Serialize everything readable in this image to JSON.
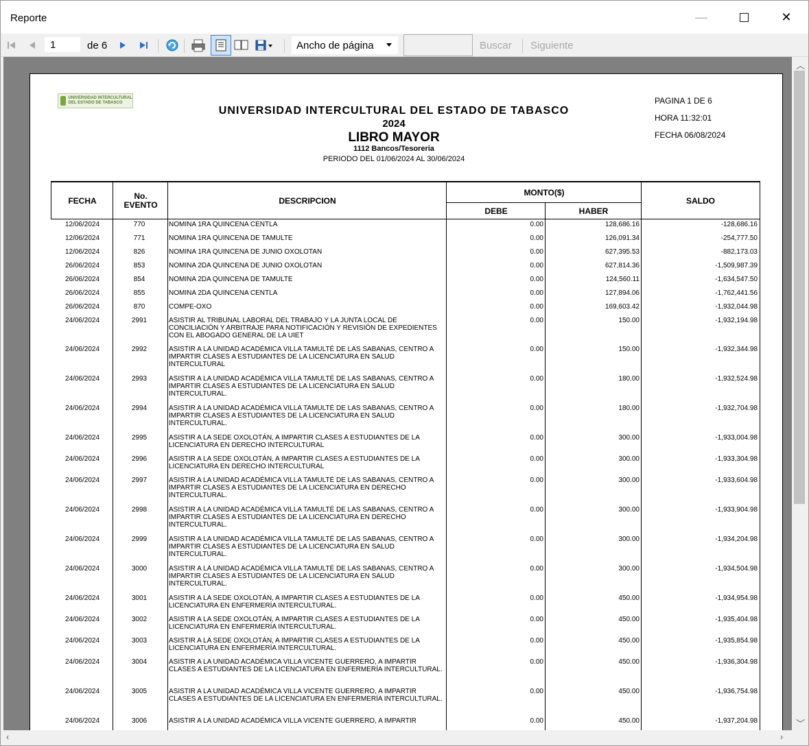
{
  "window": {
    "title": "Reporte"
  },
  "toolbar": {
    "page_current": "1",
    "page_of": "de 6",
    "zoom": "Ancho de página",
    "search_label": "Buscar",
    "next_label": "Siguiente"
  },
  "report": {
    "institution": "UNIVERSIDAD INTERCULTURAL DEL ESTADO DE TABASCO",
    "year": "2024",
    "book": "LIBRO MAYOR",
    "account": "1112 Bancos/Tesoreria",
    "period": "PERIODO DEL 01/06/2024 AL 30/06/2024",
    "page_info": "PAGINA 1 DE 6",
    "time": "HORA  11:32:01",
    "date": "FECHA 06/08/2024",
    "logo_text": "UNIVERSIDAD INTERCULTURAL DEL ESTADO DE TABASCO"
  },
  "table": {
    "headers": {
      "fecha": "FECHA",
      "evento": "No. EVENTO",
      "descripcion": "DESCRIPCION",
      "monto": "MONTO($)",
      "debe": "DEBE",
      "haber": "HABER",
      "saldo": "SALDO"
    },
    "rows": [
      {
        "fecha": "12/06/2024",
        "evento": "770",
        "desc": "NOMINA 1RA QUINCENA CENTLA",
        "debe": "0.00",
        "haber": "128,686.16",
        "saldo": "-128,686.16"
      },
      {
        "fecha": "12/06/2024",
        "evento": "771",
        "desc": "NOMINA 1RA QUINCENA DE TAMULTE",
        "debe": "0.00",
        "haber": "126,091.34",
        "saldo": "-254,777.50"
      },
      {
        "fecha": "12/06/2024",
        "evento": "826",
        "desc": "NOMINA 1RA QUINCENA DE JUNIO OXOLOTAN",
        "debe": "0.00",
        "haber": "627,395.53",
        "saldo": "-882,173.03"
      },
      {
        "fecha": "26/06/2024",
        "evento": "853",
        "desc": "NOMINA 2DA QUINCENA DE JUNIO OXOLOTAN",
        "debe": "0.00",
        "haber": "627,814.36",
        "saldo": "-1,509,987.39"
      },
      {
        "fecha": "26/06/2024",
        "evento": "854",
        "desc": "NOMINA 2DA QUINCENA DE TAMULTE",
        "debe": "0.00",
        "haber": "124,560.11",
        "saldo": "-1,634,547.50"
      },
      {
        "fecha": "26/06/2024",
        "evento": "855",
        "desc": "NOMINA 2DA QUINCENA CENTLA",
        "debe": "0.00",
        "haber": "127,894.06",
        "saldo": "-1,762,441.56"
      },
      {
        "fecha": "26/06/2024",
        "evento": "870",
        "desc": "COMPE-OXO",
        "debe": "0.00",
        "haber": "169,603.42",
        "saldo": "-1,932,044.98"
      },
      {
        "fecha": "24/06/2024",
        "evento": "2991",
        "desc": "ASISTIR AL TRIBUNAL LABORAL DEL TRABAJO Y LA JUNTA LOCAL DE CONCILIACIÓN Y ARBITRAJE PARA NOTIFICACIÓN Y REVISIÓN DE EXPEDIENTES CON EL ABOGADO GENERAL DE LA UIET",
        "debe": "0.00",
        "haber": "150.00",
        "saldo": "-1,932,194.98"
      },
      {
        "fecha": "24/06/2024",
        "evento": "2992",
        "desc": "ASISTIR A LA UNIDAD ACADÉMICA VILLA TAMULTÉ DE LAS SABANAS, CENTRO A IMPARTIR CLASES A ESTUDIANTES DE LA LICENCIATURA EN SALUD INTERCULTURAL",
        "debe": "0.00",
        "haber": "150.00",
        "saldo": "-1,932,344.98"
      },
      {
        "fecha": "24/06/2024",
        "evento": "2993",
        "desc": "ASISTIR A LA UNIDAD ACADÉMICA VILLA TAMULTÉ DE LAS SABANAS, CENTRO A IMPARTIR CLASES A ESTUDIANTES DE LA LICENCIATURA EN SALUD INTERCULTURAL.",
        "debe": "0.00",
        "haber": "180.00",
        "saldo": "-1,932,524.98"
      },
      {
        "fecha": "24/06/2024",
        "evento": "2994",
        "desc": "ASISTIR A LA UNIDAD ACADÉMICA VILLA TAMULTÉ DE LAS SABANAS, CENTRO A IMPARTIR CLASES A ESTUDIANTES DE LA LICENCIATURA EN SALUD INTERCULTURAL.",
        "debe": "0.00",
        "haber": "180.00",
        "saldo": "-1,932,704.98"
      },
      {
        "fecha": "24/06/2024",
        "evento": "2995",
        "desc": "ASISTIR A LA SEDE OXOLOTÁN, A IMPARTIR CLASES A ESTUDIANTES DE LA LICENCIATURA EN DERECHO INTERCULTURAL",
        "debe": "0.00",
        "haber": "300.00",
        "saldo": "-1,933,004.98"
      },
      {
        "fecha": "24/06/2024",
        "evento": "2996",
        "desc": "ASISTIR A LA SEDE OXOLOTÁN, A IMPARTIR CLASES A ESTUDIANTES DE LA LICENCIATURA EN DERECHO INTERCULTURAL",
        "debe": "0.00",
        "haber": "300.00",
        "saldo": "-1,933,304.98"
      },
      {
        "fecha": "24/06/2024",
        "evento": "2997",
        "desc": "ASISTIR A LA UNIDAD ACADÉMICA VILLA TAMULTÉ DE LAS SABANAS, CENTRO A IMPARTIR CLASES A ESTUDIANTES DE LA LICENCIATURA EN DERECHO INTERCULTURAL.",
        "debe": "0.00",
        "haber": "300.00",
        "saldo": "-1,933,604.98"
      },
      {
        "fecha": "24/06/2024",
        "evento": "2998",
        "desc": "ASISTIR A LA UNIDAD ACADÉMICA VILLA TAMULTÉ DE LAS SABANAS, CENTRO A IMPARTIR CLASES A ESTUDIANTES DE LA LICENCIATURA EN DERECHO INTERCULTURAL.",
        "debe": "0.00",
        "haber": "300.00",
        "saldo": "-1,933,904.98"
      },
      {
        "fecha": "24/06/2024",
        "evento": "2999",
        "desc": "ASISTIR A LA UNIDAD ACADÉMICA VILLA TAMULTÉ DE LAS SABANAS, CENTRO A IMPARTIR CLASES A ESTUDIANTES DE LA LICENCIATURA EN SALUD INTERCULTURAL.",
        "debe": "0.00",
        "haber": "300.00",
        "saldo": "-1,934,204.98"
      },
      {
        "fecha": "24/06/2024",
        "evento": "3000",
        "desc": "ASISTIR A LA UNIDAD ACADÉMICA VILLA TAMULTÉ DE LAS SABANAS, CENTRO A IMPARTIR CLASES A ESTUDIANTES DE LA LICENCIATURA EN SALUD INTERCULTURAL.",
        "debe": "0.00",
        "haber": "300.00",
        "saldo": "-1,934,504.98"
      },
      {
        "fecha": "24/06/2024",
        "evento": "3001",
        "desc": "ASISTIR A LA SEDE OXOLOTÁN, A IMPARTIR CLASES A ESTUDIANTES DE LA LICENCIATURA EN ENFERMERÍA INTERCULTURAL.",
        "debe": "0.00",
        "haber": "450.00",
        "saldo": "-1,934,954.98"
      },
      {
        "fecha": "24/06/2024",
        "evento": "3002",
        "desc": "ASISTIR A LA SEDE OXOLOTÁN, A IMPARTIR CLASES A ESTUDIANTES DE LA LICENCIATURA EN ENFERMERÍA INTERCULTURAL.",
        "debe": "0.00",
        "haber": "450.00",
        "saldo": "-1,935,404.98"
      },
      {
        "fecha": "24/06/2024",
        "evento": "3003",
        "desc": "ASISTIR A LA SEDE OXOLOTÁN, A IMPARTIR CLASES A ESTUDIANTES DE LA LICENCIATURA EN ENFERMERÍA INTERCULTURAL.",
        "debe": "0.00",
        "haber": "450.00",
        "saldo": "-1,935,854.98"
      },
      {
        "fecha": "24/06/2024",
        "evento": "3004",
        "desc": "ASISTIR A LA UNIDAD ACADÉMICA VILLA VICENTE GUERRERO, A IMPARTIR CLASES A ESTUDIANTES DE LA LICENCIATURA EN ENFERMERÍA INTERCULTURAL.",
        "debe": "0.00",
        "haber": "450.00",
        "saldo": "-1,936,304.98"
      },
      {
        "fecha": "24/06/2024",
        "evento": "3005",
        "desc": "ASISTIR A LA UNIDAD ACADÉMICA VILLA VICENTE GUERRERO, A IMPARTIR CLASES A ESTUDIANTES DE LA LICENCIATURA EN ENFERMERÍA INTERCULTURAL.",
        "debe": "0.00",
        "haber": "450.00",
        "saldo": "-1,936,754.98"
      },
      {
        "fecha": "24/06/2024",
        "evento": "3006",
        "desc": "ASISTIR A LA UNIDAD ACADÉMICA VILLA VICENTE GUERRERO, A IMPARTIR",
        "debe": "0.00",
        "haber": "450.00",
        "saldo": "-1,937,204.98"
      }
    ]
  }
}
